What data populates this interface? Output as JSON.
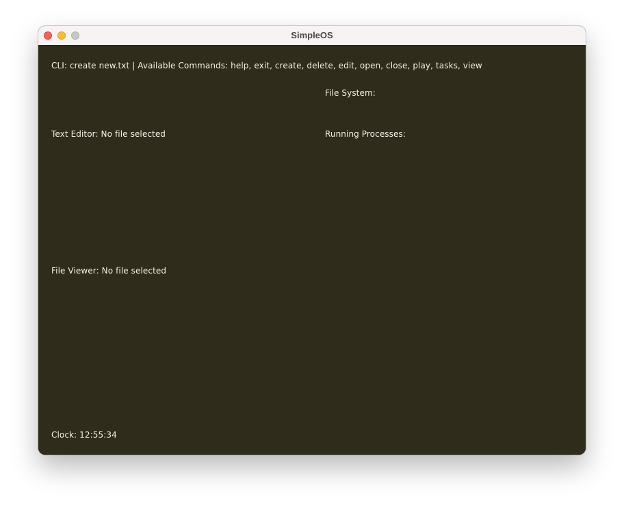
{
  "window": {
    "title": "SimpleOS",
    "controls": {
      "close_icon": "close-icon",
      "minimize_icon": "minimize-icon",
      "zoom_icon": "zoom-icon"
    }
  },
  "cli": {
    "text": "CLI: create new.txt | Available Commands: help, exit, create, delete, edit, open, close, play, tasks, view"
  },
  "file_system": {
    "label": "File System:"
  },
  "text_editor": {
    "label": "Text Editor: No file selected"
  },
  "running_processes": {
    "label": "Running Processes:"
  },
  "file_viewer": {
    "label": "File Viewer: No file selected"
  },
  "clock": {
    "label": "Clock: 12:55:34"
  },
  "colors": {
    "background": "#2f2c1b",
    "text": "#f2f0e6",
    "titlebar": "#f6f3f2"
  }
}
